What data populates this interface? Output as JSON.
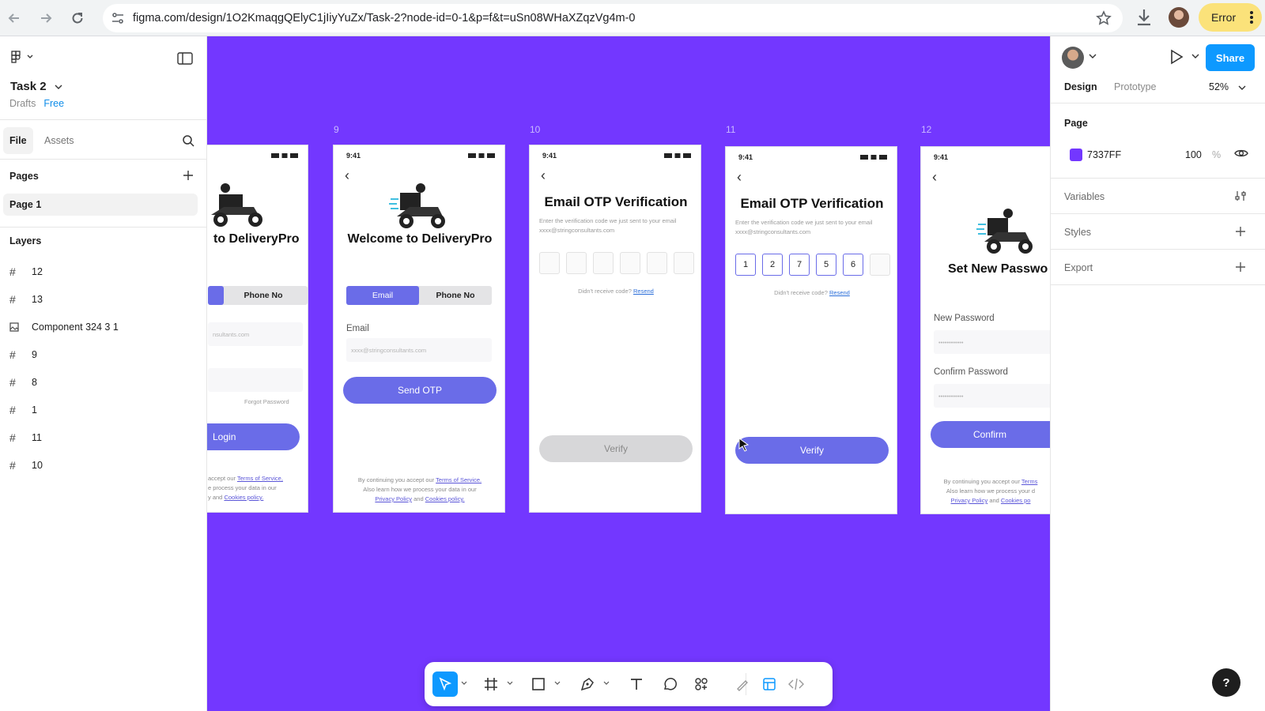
{
  "browser": {
    "url": "figma.com/design/1O2KmaqgQElyC1jIiyYuZx/Task-2?node-id=0-1&p=f&t=uSn08WHaXZqzVg4m-0",
    "error_label": "Error"
  },
  "left_panel": {
    "file_name": "Task 2",
    "location": "Drafts",
    "plan": "Free",
    "tabs": [
      "File",
      "Assets"
    ],
    "pages_heading": "Pages",
    "pages": [
      "Page 1"
    ],
    "layers_heading": "Layers",
    "layers": [
      {
        "name": "12",
        "icon": "frame-icon"
      },
      {
        "name": "13",
        "icon": "frame-icon"
      },
      {
        "name": "Component 324 3 1",
        "icon": "image-icon"
      },
      {
        "name": "9",
        "icon": "frame-icon"
      },
      {
        "name": "8",
        "icon": "frame-icon"
      },
      {
        "name": "1",
        "icon": "frame-icon"
      },
      {
        "name": "11",
        "icon": "frame-icon"
      },
      {
        "name": "10",
        "icon": "frame-icon"
      }
    ]
  },
  "canvas": {
    "background": "#7337FF",
    "frames": [
      {
        "title": "to DeliveryPro",
        "toggle_b": "Phone No",
        "input": "nsultants.com",
        "forgot": "Forgot Password",
        "button": "Login",
        "footer_1": "accept our",
        "footer_link1": "Terms of Service,",
        "footer_2": "e process your data in our",
        "footer_3": "y and",
        "footer_link2": "Cookies policy."
      },
      {
        "label": "9",
        "time": "9:41",
        "title": "Welcome to DeliveryPro",
        "toggle_a": "Email",
        "toggle_b": "Phone No",
        "field_label": "Email",
        "placeholder": "xxxx@stringconsultants.com",
        "button": "Send OTP",
        "footer_1": "By continuing you accept our",
        "footer_link1": "Terms of Service.",
        "footer_2": "Also learn how we process your data in our",
        "footer_link2": "Privacy Policy",
        "footer_and": "and",
        "footer_link3": "Cookies policy."
      },
      {
        "label": "10",
        "time": "9:41",
        "title": "Email OTP Verification",
        "subtitle": "Enter the verification code we just sent to your email xxxx@stringconsultants.com",
        "resend_q": "Didn't receive code?",
        "resend": "Resend",
        "button": "Verify"
      },
      {
        "label": "11",
        "time": "9:41",
        "title": "Email OTP Verification",
        "subtitle": "Enter the verification code we just sent to your email xxxx@stringconsultants.com",
        "digits": [
          "1",
          "2",
          "7",
          "5",
          "6",
          ""
        ],
        "resend_q": "Didn't receive code?",
        "resend": "Resend",
        "button": "Verify"
      },
      {
        "label": "12",
        "time": "9:41",
        "title": "Set New Passwo",
        "field1": "New Password",
        "field1_ph": "••••••••••••",
        "field2": "Confirm Password",
        "field2_ph": "••••••••••••",
        "button": "Confirm",
        "footer_1": "By continuing you accept our",
        "footer_link1": "Terms",
        "footer_2": "Also learn how we process your d",
        "footer_link2": "Privacy Policy",
        "footer_and": "and",
        "footer_link3": "Cookies po"
      }
    ]
  },
  "right_panel": {
    "share": "Share",
    "tabs": [
      "Design",
      "Prototype"
    ],
    "zoom": "52%",
    "page_heading": "Page",
    "fill_hex": "7337FF",
    "fill_opacity": "100",
    "fill_unit": "%",
    "sections": [
      "Variables",
      "Styles",
      "Export"
    ]
  },
  "help": "?"
}
